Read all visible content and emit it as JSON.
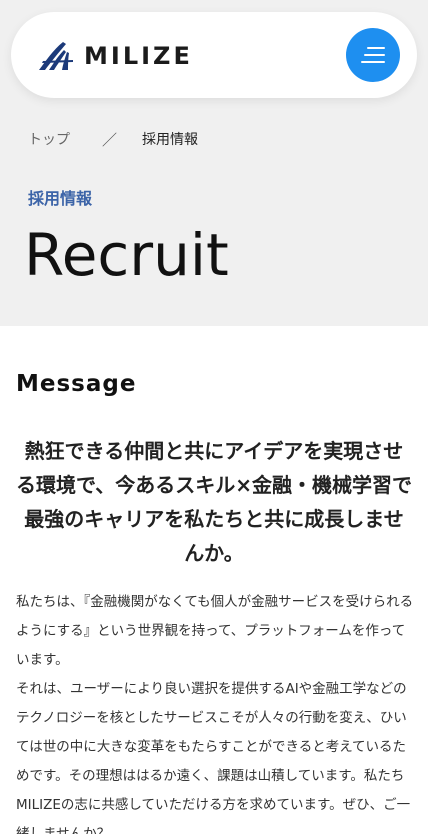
{
  "header": {
    "logo_text": "MILIZE",
    "colors": {
      "menu_button": "#1e8ff0",
      "logo_mark": "#1c3a7a"
    }
  },
  "breadcrumb": {
    "home": "トップ",
    "separator": "／",
    "current": "採用情報"
  },
  "hero": {
    "label": "採用情報",
    "title": "Recruit"
  },
  "message": {
    "heading": "Message",
    "lead": "熱狂できる仲間と共にアイデアを実現させる環境で、今あるスキル×金融・機械学習で最強のキャリアを私たちと共に成長しませんか。",
    "paragraph_1": "私たちは、『金融機関がなくても個人が金融サービスを受けられるようにする』という世界観を持って、プラットフォームを作っています。",
    "paragraph_2": "それは、ユーザーにより良い選択を提供するAIや金融工学などのテクノロジーを核としたサービスこそが人々の行動を変え、ひいては世の中に大きな変革をもたらすことができると考えているためです。その理想ははるか遠く、課題は山積しています。私たちMILIZEの志に共感していただける方を求めています。ぜひ、ご一緒しませんか？"
  }
}
